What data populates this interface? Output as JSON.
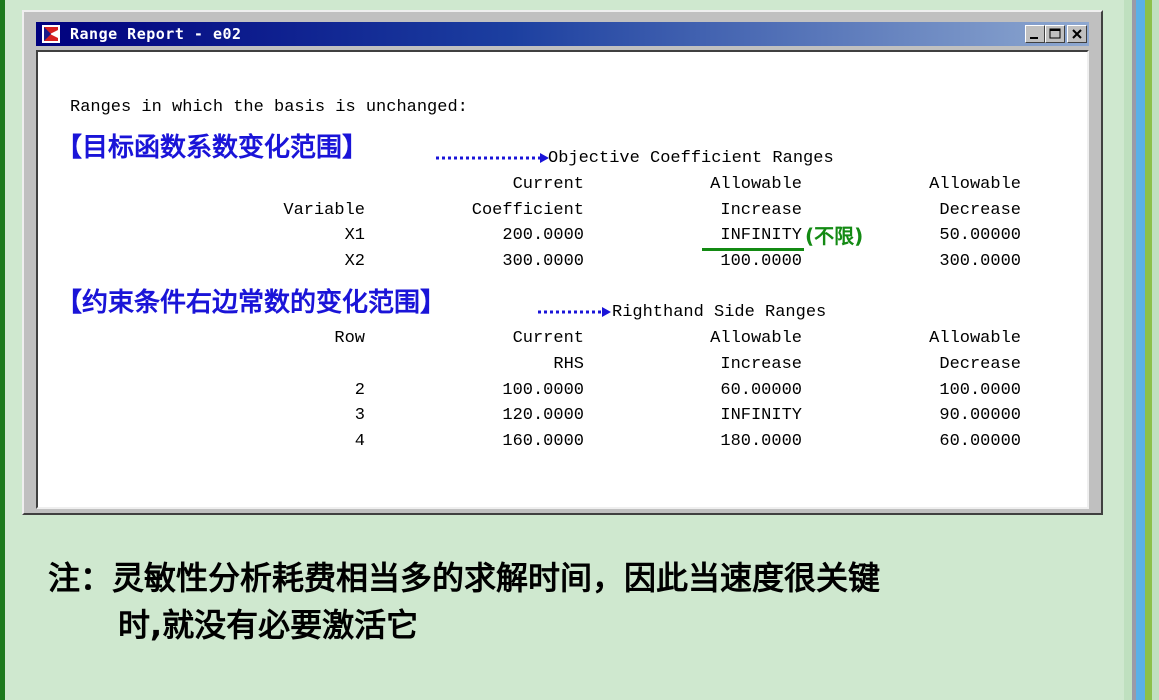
{
  "window": {
    "title": "Range Report - e02",
    "buttons": {
      "minimize": "minimize",
      "maximize": "maximize",
      "close": "close"
    }
  },
  "report": {
    "intro": "Ranges in which the basis is unchanged:",
    "objective": {
      "annotation": "【目标函数系数变化范围】",
      "heading": "Objective Coefficient Ranges",
      "headers": {
        "col1_line1": "",
        "col1_line2": "Variable",
        "col2_line1": "Current",
        "col2_line2": "Coefficient",
        "col3_line1": "Allowable",
        "col3_line2": "Increase",
        "col4_line1": "Allowable",
        "col4_line2": "Decrease"
      },
      "rows": [
        {
          "name": "X1",
          "current": "200.0000",
          "increase": "INFINITY",
          "decrease": "50.00000"
        },
        {
          "name": "X2",
          "current": "300.0000",
          "increase": "100.0000",
          "decrease": "300.0000"
        }
      ],
      "infinity_note": "(不限)"
    },
    "rhs": {
      "annotation": "【约束条件右边常数的变化范围】",
      "heading": "Righthand Side Ranges",
      "headers": {
        "col1_line1": "Row",
        "col1_line2": "",
        "col2_line1": "Current",
        "col2_line2": "RHS",
        "col3_line1": "Allowable",
        "col3_line2": "Increase",
        "col4_line1": "Allowable",
        "col4_line2": "Decrease"
      },
      "rows": [
        {
          "name": "2",
          "current": "100.0000",
          "increase": "60.00000",
          "decrease": "100.0000"
        },
        {
          "name": "3",
          "current": "120.0000",
          "increase": "INFINITY",
          "decrease": "90.00000"
        },
        {
          "name": "4",
          "current": "160.0000",
          "increase": "180.0000",
          "decrease": "60.00000"
        }
      ]
    }
  },
  "note": {
    "line1": "注：灵敏性分析耗费相当多的求解时间，因此当速度很关键",
    "line2": "时,就没有必要激活它"
  },
  "colors": {
    "annotation": "#1a14d8",
    "infinity_note": "#138a13",
    "background": "#cfe8cf",
    "titlebar": "#00007e"
  },
  "icons": {
    "app": "lingo-app-icon"
  }
}
